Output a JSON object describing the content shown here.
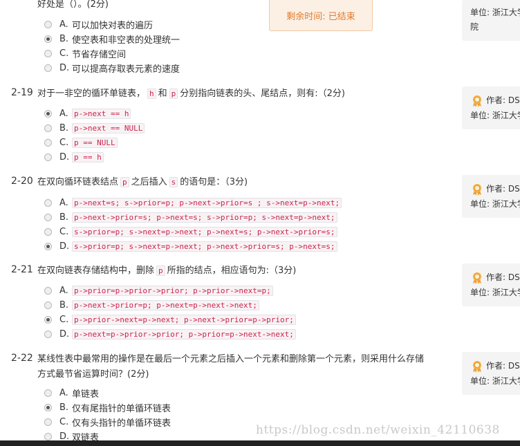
{
  "timer": {
    "label": "剩余时间: 已结束"
  },
  "questions": [
    {
      "number": "",
      "text": "好处是（）。(2分)",
      "options": [
        {
          "letter": "A.",
          "text": "可以加快对表的遍历",
          "code": false,
          "selected": false
        },
        {
          "letter": "B.",
          "text": "使空表和非空表的处理统一",
          "code": false,
          "selected": true
        },
        {
          "letter": "C.",
          "text": "节省存储空间",
          "code": false,
          "selected": false
        },
        {
          "letter": "D.",
          "text": "可以提高存取表元素的速度",
          "code": false,
          "selected": false
        }
      ],
      "side": {
        "author": "",
        "unit_label": "单位: 浙江大学",
        "extra": "院"
      }
    },
    {
      "number": "2-19",
      "text_parts": [
        "对于一非空的循环单链表，",
        "h",
        "和",
        "p",
        "分别指向链表的头、尾结点，则有:（2分)"
      ],
      "options": [
        {
          "letter": "A.",
          "text": "p->next == h",
          "code": true,
          "selected": true
        },
        {
          "letter": "B.",
          "text": "p->next == NULL",
          "code": true,
          "selected": false
        },
        {
          "letter": "C.",
          "text": "p == NULL",
          "code": true,
          "selected": false
        },
        {
          "letter": "D.",
          "text": "p == h",
          "code": true,
          "selected": false
        }
      ],
      "side": {
        "author": "作者: DS",
        "unit_label": "单位: 浙江大学"
      }
    },
    {
      "number": "2-20",
      "text_parts": [
        "在双向循环链表结点",
        "p",
        "之后插入",
        "s",
        "的语句是：（3分)"
      ],
      "options": [
        {
          "letter": "A.",
          "text": "p->next=s; s->prior=p; p->next->prior=s ; s->next=p->next;",
          "code": true,
          "selected": false
        },
        {
          "letter": "B.",
          "text": "p->next->prior=s; p->next=s; s->prior=p; s->next=p->next;",
          "code": true,
          "selected": false
        },
        {
          "letter": "C.",
          "text": "s->prior=p; s->next=p->next; p->next=s; p->next->prior=s;",
          "code": true,
          "selected": false
        },
        {
          "letter": "D.",
          "text": "s->prior=p; s->next=p->next; p->next->prior=s; p->next=s;",
          "code": true,
          "selected": true
        }
      ],
      "side": {
        "author": "作者: DS",
        "unit_label": "单位: 浙江大学"
      }
    },
    {
      "number": "2-21",
      "text_parts": [
        "在双向链表存储结构中，删除",
        "p",
        "所指的结点，相应语句为:（3分)"
      ],
      "options": [
        {
          "letter": "A.",
          "text": "p->prior=p->prior->prior; p->prior->next=p;",
          "code": true,
          "selected": false
        },
        {
          "letter": "B.",
          "text": "p->next->prior=p; p->next=p->next->next;",
          "code": true,
          "selected": false
        },
        {
          "letter": "C.",
          "text": "p->prior->next=p->next; p->next->prior=p->prior;",
          "code": true,
          "selected": true
        },
        {
          "letter": "D.",
          "text": "p->next=p->prior->prior; p->prior=p->next->next;",
          "code": true,
          "selected": false
        }
      ],
      "side": {
        "author": "作者: DS",
        "unit_label": "单位: 浙江大学"
      }
    },
    {
      "number": "2-22",
      "text_line1": "某线性表中最常用的操作是在最后一个元素之后插入一个元素和删除第一个元素，则采用什么存储",
      "text_line2": "方式最节省运算时间？(2分)",
      "options": [
        {
          "letter": "A.",
          "text": "单链表",
          "code": false,
          "selected": false
        },
        {
          "letter": "B.",
          "text": "仅有尾指针的单循环链表",
          "code": false,
          "selected": true
        },
        {
          "letter": "C.",
          "text": "仅有头指针的单循环链表",
          "code": false,
          "selected": false
        },
        {
          "letter": "D.",
          "text": "双链表",
          "code": false,
          "selected": false
        }
      ],
      "side": {
        "author": "作者: DS",
        "unit_label": "单位: 浙江大学"
      }
    }
  ],
  "watermark": "https://blog.csdn.net/weixin_42110638",
  "colors": {
    "timer_text": "#e27a2e",
    "timer_bg": "#fcf0e4",
    "code_text": "#c7254e",
    "code_bg": "#f9f2f4",
    "medal": "#f0a030"
  }
}
